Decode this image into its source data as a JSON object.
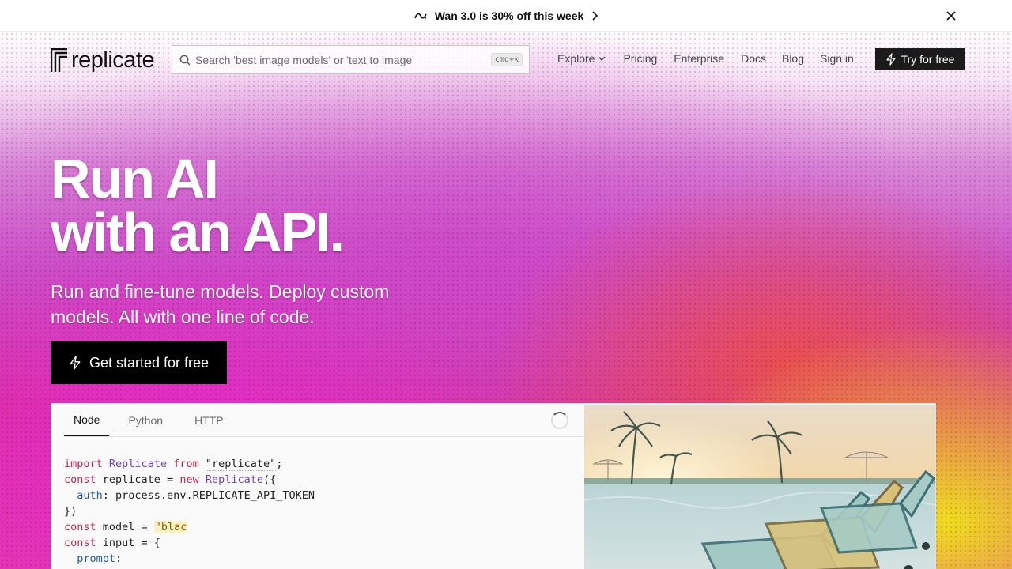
{
  "announcement": {
    "text": "Wan 3.0 is 30% off this week",
    "icon": "wave-logo-icon",
    "arrow_icon": "chevron-right-icon",
    "close_icon": "close-icon"
  },
  "nav": {
    "logo_text": "replicate",
    "search": {
      "placeholder": "Search 'best image models' or 'text to image'",
      "shortcut": "cmd+k"
    },
    "links": [
      "Explore",
      "Pricing",
      "Enterprise",
      "Docs",
      "Blog",
      "Sign in"
    ],
    "cta_label": "Try for free"
  },
  "hero": {
    "headline_line1": "Run AI",
    "headline_line2": "with an API.",
    "subhead": "Run and fine-tune models. Deploy custom models. All with one line of code.",
    "cta_label": "Get started for free"
  },
  "code_panel": {
    "tabs": [
      "Node",
      "Python",
      "HTTP"
    ],
    "active_tab": "Node",
    "code_lines": [
      "import Replicate from \"replicate\";",
      "const replicate = new Replicate({",
      "  auth: process.env.REPLICATE_API_TOKEN",
      "})",
      "const model = \"blac",
      "const input = {",
      "  prompt:"
    ],
    "image_alt": "Pool with lounge chairs and palm trees at sunset"
  },
  "colors": {
    "hero_magenta": "#d8329a",
    "hero_orange": "#ec5046",
    "hero_yellow": "#f0e614",
    "button_black": "#000000"
  }
}
